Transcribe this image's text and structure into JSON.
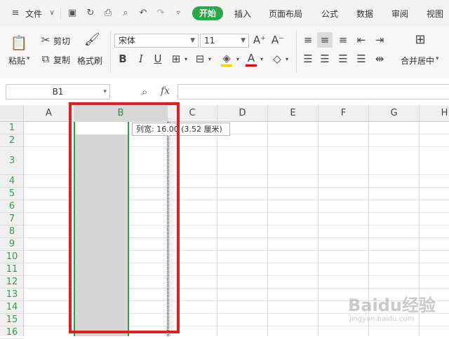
{
  "menubar": {
    "file": "文件",
    "tabs": [
      "开始",
      "插入",
      "页面布局",
      "公式",
      "数据",
      "审阅",
      "视图"
    ]
  },
  "ribbon": {
    "paste": "粘贴",
    "cut": "剪切",
    "copy": "复制",
    "format_painter": "格式刷",
    "font_name": "宋体",
    "font_size": "11",
    "bold": "B",
    "italic": "I",
    "underline": "U",
    "merge_center": "合并居中"
  },
  "formula_bar": {
    "name_box": "B1",
    "fx": "fx",
    "value": ""
  },
  "sheet": {
    "columns": [
      "A",
      "B",
      "C",
      "D",
      "E",
      "F",
      "G",
      "H"
    ],
    "rows": [
      "1",
      "2",
      "3",
      "4",
      "5",
      "6",
      "7",
      "8",
      "9",
      "10",
      "11",
      "12",
      "13",
      "14",
      "15",
      "16"
    ],
    "selected_column": "B",
    "tooltip": "列宽: 16.00 (3.52 厘米)"
  },
  "colors": {
    "accent": "#2aa84a",
    "highlight_box": "#e02020",
    "selection_border": "#2e9e40",
    "selection_fill": "#d6d6d6"
  },
  "watermark": {
    "brand": "Baidu经验",
    "url": "jingyan.baidu.com"
  }
}
